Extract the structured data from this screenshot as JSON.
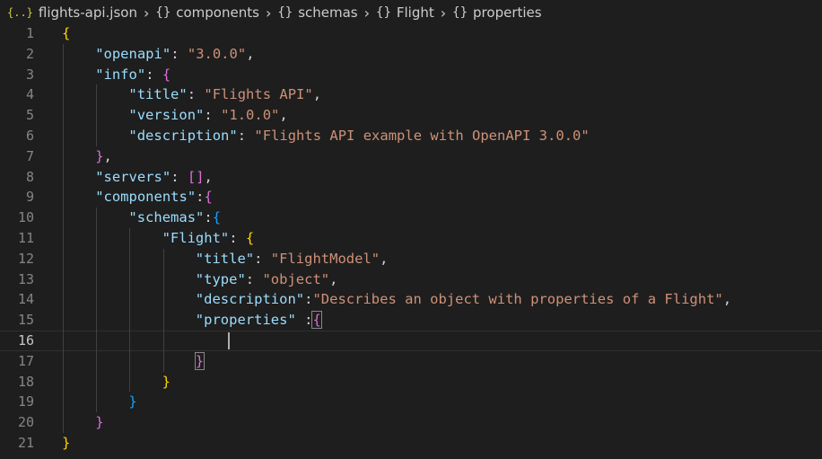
{
  "breadcrumb": [
    {
      "icon": "json-file-icon",
      "glyph": "{..}",
      "label": "flights-api.json"
    },
    {
      "icon": "braces-icon",
      "glyph": "{}",
      "label": "components"
    },
    {
      "icon": "braces-icon",
      "glyph": "{}",
      "label": "schemas"
    },
    {
      "icon": "braces-icon",
      "glyph": "{}",
      "label": "Flight"
    },
    {
      "icon": "braces-icon",
      "glyph": "{}",
      "label": "properties"
    }
  ],
  "breadcrumb_separator": "›",
  "editor": {
    "current_line": 16,
    "lines": [
      {
        "n": "1",
        "indent": 0,
        "tokens": [
          {
            "t": "{",
            "c": "b1"
          }
        ]
      },
      {
        "n": "2",
        "indent": 1,
        "tokens": [
          {
            "t": "\"openapi\"",
            "c": "tk-key"
          },
          {
            "t": ": ",
            "c": "tk-p"
          },
          {
            "t": "\"3.0.0\"",
            "c": "tk-str"
          },
          {
            "t": ",",
            "c": "tk-p"
          }
        ]
      },
      {
        "n": "3",
        "indent": 1,
        "tokens": [
          {
            "t": "\"info\"",
            "c": "tk-key"
          },
          {
            "t": ": ",
            "c": "tk-p"
          },
          {
            "t": "{",
            "c": "b2"
          }
        ]
      },
      {
        "n": "4",
        "indent": 2,
        "tokens": [
          {
            "t": "\"title\"",
            "c": "tk-key"
          },
          {
            "t": ": ",
            "c": "tk-p"
          },
          {
            "t": "\"Flights API\"",
            "c": "tk-str"
          },
          {
            "t": ",",
            "c": "tk-p"
          }
        ]
      },
      {
        "n": "5",
        "indent": 2,
        "tokens": [
          {
            "t": "\"version\"",
            "c": "tk-key"
          },
          {
            "t": ": ",
            "c": "tk-p"
          },
          {
            "t": "\"1.0.0\"",
            "c": "tk-str"
          },
          {
            "t": ",",
            "c": "tk-p"
          }
        ]
      },
      {
        "n": "6",
        "indent": 2,
        "tokens": [
          {
            "t": "\"description\"",
            "c": "tk-key"
          },
          {
            "t": ": ",
            "c": "tk-p"
          },
          {
            "t": "\"Flights API example with OpenAPI 3.0.0\"",
            "c": "tk-str"
          }
        ]
      },
      {
        "n": "7",
        "indent": 1,
        "tokens": [
          {
            "t": "}",
            "c": "b2"
          },
          {
            "t": ",",
            "c": "tk-p"
          }
        ]
      },
      {
        "n": "8",
        "indent": 1,
        "tokens": [
          {
            "t": "\"servers\"",
            "c": "tk-key"
          },
          {
            "t": ": ",
            "c": "tk-p"
          },
          {
            "t": "[]",
            "c": "b2"
          },
          {
            "t": ",",
            "c": "tk-p"
          }
        ]
      },
      {
        "n": "9",
        "indent": 1,
        "tokens": [
          {
            "t": "\"components\"",
            "c": "tk-key"
          },
          {
            "t": ":",
            "c": "tk-p"
          },
          {
            "t": "{",
            "c": "b2"
          }
        ]
      },
      {
        "n": "10",
        "indent": 2,
        "tokens": [
          {
            "t": "\"schemas\"",
            "c": "tk-key"
          },
          {
            "t": ":",
            "c": "tk-p"
          },
          {
            "t": "{",
            "c": "b3"
          }
        ]
      },
      {
        "n": "11",
        "indent": 3,
        "tokens": [
          {
            "t": "\"Flight\"",
            "c": "tk-key"
          },
          {
            "t": ": ",
            "c": "tk-p"
          },
          {
            "t": "{",
            "c": "b1"
          }
        ]
      },
      {
        "n": "12",
        "indent": 4,
        "tokens": [
          {
            "t": "\"title\"",
            "c": "tk-key"
          },
          {
            "t": ": ",
            "c": "tk-p"
          },
          {
            "t": "\"FlightModel\"",
            "c": "tk-str"
          },
          {
            "t": ",",
            "c": "tk-p"
          }
        ]
      },
      {
        "n": "13",
        "indent": 4,
        "tokens": [
          {
            "t": "\"type\"",
            "c": "tk-key"
          },
          {
            "t": ": ",
            "c": "tk-p"
          },
          {
            "t": "\"object\"",
            "c": "tk-str"
          },
          {
            "t": ",",
            "c": "tk-p"
          }
        ]
      },
      {
        "n": "14",
        "indent": 4,
        "tokens": [
          {
            "t": "\"description\"",
            "c": "tk-key"
          },
          {
            "t": ":",
            "c": "tk-p"
          },
          {
            "t": "\"Describes an object with properties of a Flight\"",
            "c": "tk-str"
          },
          {
            "t": ",",
            "c": "tk-p"
          }
        ]
      },
      {
        "n": "15",
        "indent": 4,
        "tokens": [
          {
            "t": "\"properties\"",
            "c": "tk-key"
          },
          {
            "t": " :",
            "c": "tk-p"
          },
          {
            "t": "{",
            "c": "b2 bm"
          }
        ]
      },
      {
        "n": "16",
        "indent": 0,
        "tokens": []
      },
      {
        "n": "17",
        "indent": 4,
        "tokens": [
          {
            "t": "}",
            "c": "b2 bm"
          }
        ]
      },
      {
        "n": "18",
        "indent": 3,
        "tokens": [
          {
            "t": "}",
            "c": "b1"
          }
        ]
      },
      {
        "n": "19",
        "indent": 2,
        "tokens": [
          {
            "t": "}",
            "c": "b3"
          }
        ]
      },
      {
        "n": "20",
        "indent": 1,
        "tokens": [
          {
            "t": "}",
            "c": "b2"
          }
        ]
      },
      {
        "n": "21",
        "indent": 0,
        "tokens": [
          {
            "t": "}",
            "c": "b1"
          }
        ]
      }
    ]
  },
  "colors": {
    "background": "#1e1e1e",
    "key": "#9cdcfe",
    "string": "#ce9178",
    "bracket_gold": "#ffd700",
    "bracket_orchid": "#da70d6",
    "bracket_blue": "#179fff",
    "line_number": "#858585"
  }
}
